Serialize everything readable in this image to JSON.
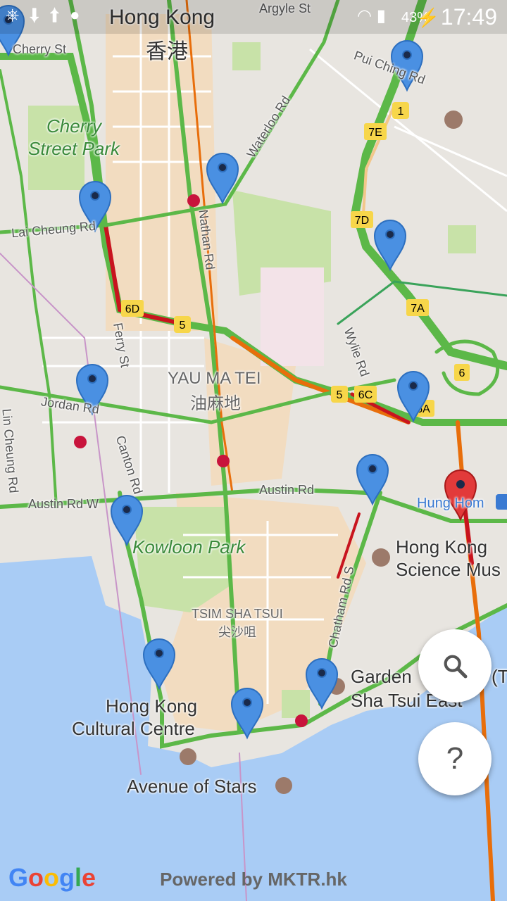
{
  "status_bar": {
    "time": "17:49",
    "battery": "43%",
    "left_icons": [
      "usb-icon",
      "download-icon",
      "upload-icon",
      "notification-icon"
    ],
    "right_icons": [
      "wifi-icon",
      "signal-icon",
      "battery-charging-icon"
    ]
  },
  "map": {
    "colors": {
      "water": "#a9ccf5",
      "land": "#e8e5e0",
      "park": "#c8e2a8",
      "urban": "#f2dcc0",
      "traffic_green": "#5cb848",
      "traffic_orange": "#e86e0b",
      "traffic_red": "#c8141e",
      "marker_blue": "#4a90e2",
      "marker_red": "#e23a3a"
    },
    "labels": {
      "hong_kong_en": "Hong Kong",
      "hong_kong_zh": "香港",
      "cherry_st": "Cherry St",
      "cherry_street_park_1": "Cherry",
      "cherry_street_park_2": "Street Park",
      "pui_ching_rd": "Pui Ching Rd",
      "waterloo_rd": "Waterloo Rd",
      "argyle_st": "Argyle St",
      "lai_cheung_rd": "Lai Cheung Rd",
      "nathan_rd": "Nathan Rd",
      "ferry_st": "Ferry St",
      "wylie_rd": "Wylie Rd",
      "yau_ma_tei_en": "YAU MA TEI",
      "yau_ma_tei_zh": "油麻地",
      "jordan_rd": "Jordan Rd",
      "lin_cheung_rd": "Lin Cheung Rd",
      "canton_rd": "Canton Rd",
      "austin_rd": "Austin Rd",
      "austin_rd_w": "Austin Rd W",
      "hung_hom": "Hung Hom",
      "kowloon_park": "Kowloon Park",
      "hk_science_museum_1": "Hong Kong",
      "hk_science_museum_2": "Science Mus",
      "chatham_rd_s": "Chatham Rd S",
      "tsim_sha_tsui_en": "TSIM SHA TSUI",
      "tsim_sha_tsui_zh": "尖沙咀",
      "garden_1": "Garden",
      "garden_1b": "(T",
      "garden_2": "Sha Tsui East",
      "hk_cultural_centre_1": "Hong Kong",
      "hk_cultural_centre_2": "Cultural Centre",
      "avenue_of_stars": "Avenue of Stars"
    },
    "route_shields": [
      "1",
      "7E",
      "7D",
      "7A",
      "6",
      "6A",
      "6C",
      "5",
      "5",
      "6D"
    ],
    "markers_blue_count": 12,
    "markers_red_count": 1
  },
  "buttons": {
    "search_icon": "search-icon",
    "help_label": "?"
  },
  "footer": {
    "google_logo": "Google",
    "powered_by": "Powered by MKTR.hk"
  }
}
